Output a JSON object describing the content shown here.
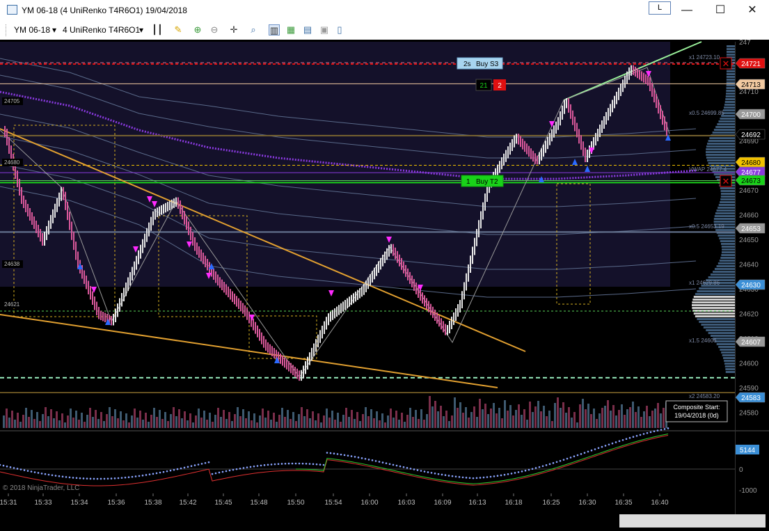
{
  "window": {
    "title": "YM 06-18 (4 UniRenko T4R6O1)  19/04/2018",
    "layout_badge": "L",
    "minimize_glyph": "—",
    "maximize_glyph": "☐",
    "close_glyph": "✕"
  },
  "toolbar": {
    "instrument": "YM 06-18",
    "bar_type": "4 UniRenko T4R6O1",
    "dropdown_glyph": "▾"
  },
  "chart": {
    "background": "#000000",
    "session_shade": "#14112a",
    "up_color": "#e6e6e6",
    "down_color": "#d8589a",
    "price_ticks": [
      "24710",
      "24700",
      "24690",
      "24680",
      "24670",
      "24660",
      "24650",
      "24640",
      "24630",
      "24620",
      "24610",
      "24600",
      "24590",
      "24580"
    ],
    "time_ticks": [
      "15:31",
      "15:33",
      "15:34",
      "15:36",
      "15:38",
      "15:42",
      "15:45",
      "15:48",
      "15:50",
      "15:54",
      "16:00",
      "16:03",
      "16:09",
      "16:13",
      "16:18",
      "16:25",
      "16:30",
      "16:35",
      "16:40"
    ],
    "left_levels": [
      "24705",
      "24680",
      "24638",
      "24621"
    ],
    "right_badges": [
      {
        "text": "24721",
        "bg": "#e01010",
        "fg": "#ffffff"
      },
      {
        "text": "24713",
        "bg": "#f1c9a0",
        "fg": "#000000"
      },
      {
        "text": "24700",
        "bg": "#9a9a9a",
        "fg": "#ffffff"
      },
      {
        "text": "24692",
        "bg": "#000000",
        "fg": "#ffffff"
      },
      {
        "text": "24680",
        "bg": "#f2c200",
        "fg": "#000000"
      },
      {
        "text": "24677",
        "bg": "#8a3adf",
        "fg": "#ffffff"
      },
      {
        "text": "24673",
        "bg": "#19d219",
        "fg": "#000000"
      },
      {
        "text": "24653",
        "bg": "#9a9a9a",
        "fg": "#ffffff"
      },
      {
        "text": "24630",
        "bg": "#3b8fd6",
        "fg": "#ffffff"
      },
      {
        "text": "24607",
        "bg": "#9a9a9a",
        "fg": "#ffffff"
      },
      {
        "text": "24583",
        "bg": "#3b8fd6",
        "fg": "#ffffff"
      }
    ],
    "band_labels": [
      {
        "text": "x1   24723.10"
      },
      {
        "text": "x0.5   24699.85"
      },
      {
        "text": "VWAP 24677.4"
      },
      {
        "text": "x0.5   24653.19"
      },
      {
        "text": "x1   24629.86"
      },
      {
        "text": "x1.5   24606"
      },
      {
        "text": "x2   24583.20"
      }
    ],
    "orders": [
      {
        "qty": "2s",
        "label": "Buy S3"
      },
      {
        "qty": "1",
        "label": "Buy T2"
      }
    ],
    "counter_a": "21",
    "counter_b": "2",
    "composite": {
      "line1": "Composite Start:",
      "line2": "19/04/2018 (0d)"
    },
    "copyright": "© 2018 NinjaTrader, LLC",
    "indicator": {
      "value_badge": "5144",
      "ticks": [
        "0",
        "-1000"
      ]
    }
  }
}
